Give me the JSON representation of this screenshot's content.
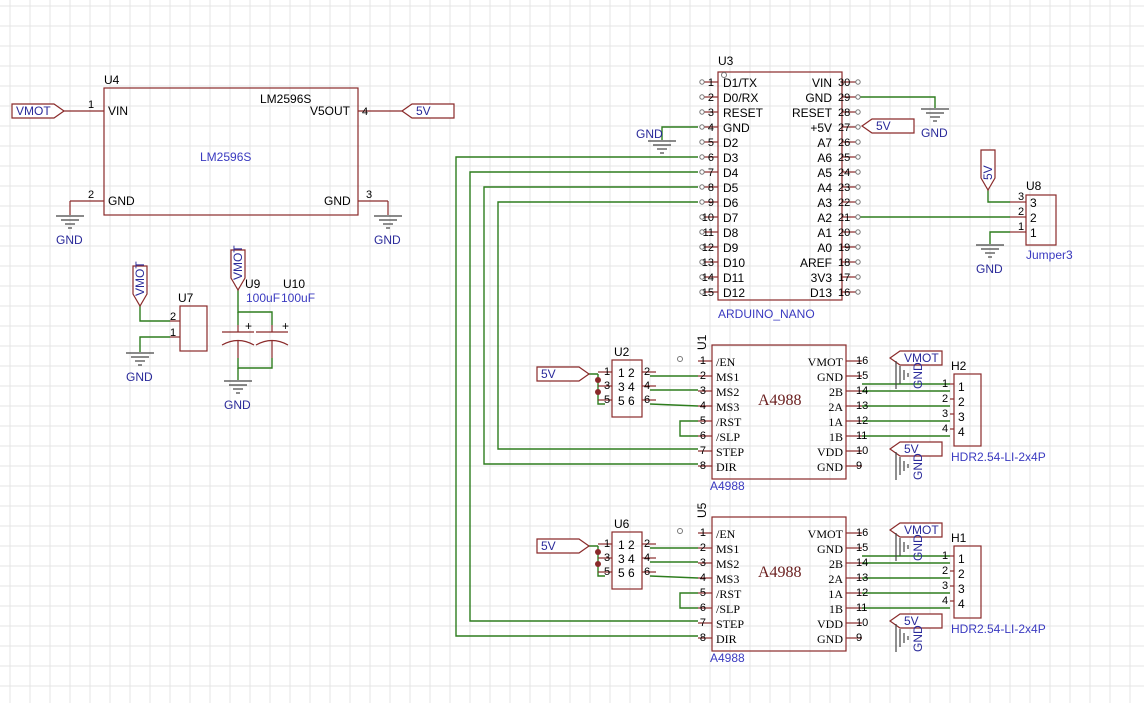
{
  "components": {
    "u4": {
      "designator": "U4",
      "value": "LM2596S",
      "center_label": "LM2596S",
      "left": [
        {
          "num": "1",
          "label": "VIN"
        },
        {
          "num": "2",
          "label": "GND"
        }
      ],
      "right": [
        {
          "num": "4",
          "label": "V5OUT"
        },
        {
          "num": "3",
          "label": "GND"
        }
      ]
    },
    "u3": {
      "designator": "U3",
      "value": "ARDUINO_NANO",
      "left": [
        {
          "num": "1",
          "label": "D1/TX"
        },
        {
          "num": "2",
          "label": "D0/RX"
        },
        {
          "num": "3",
          "label": "RESET"
        },
        {
          "num": "4",
          "label": "GND"
        },
        {
          "num": "5",
          "label": "D2"
        },
        {
          "num": "6",
          "label": "D3"
        },
        {
          "num": "7",
          "label": "D4"
        },
        {
          "num": "8",
          "label": "D5"
        },
        {
          "num": "9",
          "label": "D6"
        },
        {
          "num": "10",
          "label": "D7"
        },
        {
          "num": "11",
          "label": "D8"
        },
        {
          "num": "12",
          "label": "D9"
        },
        {
          "num": "13",
          "label": "D10"
        },
        {
          "num": "14",
          "label": "D11"
        },
        {
          "num": "15",
          "label": "D12"
        }
      ],
      "right": [
        {
          "num": "30",
          "label": "VIN"
        },
        {
          "num": "29",
          "label": "GND"
        },
        {
          "num": "28",
          "label": "RESET"
        },
        {
          "num": "27",
          "label": "+5V"
        },
        {
          "num": "26",
          "label": "A7"
        },
        {
          "num": "25",
          "label": "A6"
        },
        {
          "num": "24",
          "label": "A5"
        },
        {
          "num": "23",
          "label": "A4"
        },
        {
          "num": "22",
          "label": "A3"
        },
        {
          "num": "21",
          "label": "A2"
        },
        {
          "num": "20",
          "label": "A1"
        },
        {
          "num": "19",
          "label": "A0"
        },
        {
          "num": "18",
          "label": "AREF"
        },
        {
          "num": "17",
          "label": "3V3"
        },
        {
          "num": "16",
          "label": "D13"
        }
      ]
    },
    "u8": {
      "designator": "U8",
      "value": "Jumper3",
      "pins": [
        "3",
        "2",
        "1"
      ]
    },
    "u7": {
      "designator": "U7",
      "pins": [
        "2",
        "1"
      ]
    },
    "u9": {
      "designator": "U9",
      "value": "100uF"
    },
    "u10": {
      "designator": "U10",
      "value": "100uF"
    },
    "u1": {
      "designator": "U1",
      "value": "A4988",
      "center_label": "A4988",
      "left": [
        {
          "num": "1",
          "label": "/EN"
        },
        {
          "num": "2",
          "label": "MS1"
        },
        {
          "num": "3",
          "label": "MS2"
        },
        {
          "num": "4",
          "label": "MS3"
        },
        {
          "num": "5",
          "label": "/RST"
        },
        {
          "num": "6",
          "label": "/SLP"
        },
        {
          "num": "7",
          "label": "STEP"
        },
        {
          "num": "8",
          "label": "DIR"
        }
      ],
      "right": [
        {
          "num": "16",
          "label": "VMOT"
        },
        {
          "num": "15",
          "label": "GND"
        },
        {
          "num": "14",
          "label": "2B"
        },
        {
          "num": "13",
          "label": "2A"
        },
        {
          "num": "12",
          "label": "1A"
        },
        {
          "num": "11",
          "label": "1B"
        },
        {
          "num": "10",
          "label": "VDD"
        },
        {
          "num": "9",
          "label": "GND"
        }
      ]
    },
    "u5": {
      "designator": "U5",
      "value": "A4988",
      "center_label": "A4988",
      "left": [
        {
          "num": "1",
          "label": "/EN"
        },
        {
          "num": "2",
          "label": "MS1"
        },
        {
          "num": "3",
          "label": "MS2"
        },
        {
          "num": "4",
          "label": "MS3"
        },
        {
          "num": "5",
          "label": "/RST"
        },
        {
          "num": "6",
          "label": "/SLP"
        },
        {
          "num": "7",
          "label": "STEP"
        },
        {
          "num": "8",
          "label": "DIR"
        }
      ],
      "right": [
        {
          "num": "16",
          "label": "VMOT"
        },
        {
          "num": "15",
          "label": "GND"
        },
        {
          "num": "14",
          "label": "2B"
        },
        {
          "num": "13",
          "label": "2A"
        },
        {
          "num": "12",
          "label": "1A"
        },
        {
          "num": "11",
          "label": "1B"
        },
        {
          "num": "10",
          "label": "VDD"
        },
        {
          "num": "9",
          "label": "GND"
        }
      ]
    },
    "u2": {
      "designator": "U2",
      "pins": {
        "left": [
          "1",
          "3",
          "5"
        ],
        "inner": [
          "1 2",
          "3 4",
          "5 6"
        ],
        "right": [
          "2",
          "4",
          "6"
        ]
      }
    },
    "u6": {
      "designator": "U6",
      "pins": {
        "left": [
          "1",
          "3",
          "5"
        ],
        "inner": [
          "1 2",
          "3 4",
          "5 6"
        ],
        "right": [
          "2",
          "4",
          "6"
        ]
      }
    },
    "h2": {
      "designator": "H2",
      "value": "HDR2.54-LI-2x4P",
      "pins": [
        "1",
        "2",
        "3",
        "4"
      ]
    },
    "h1": {
      "designator": "H1",
      "value": "HDR2.54-LI-2x4P",
      "pins": [
        "1",
        "2",
        "3",
        "4"
      ]
    }
  },
  "nets": {
    "vmot": "VMOT",
    "v5": "5V",
    "gnd": "GND"
  }
}
